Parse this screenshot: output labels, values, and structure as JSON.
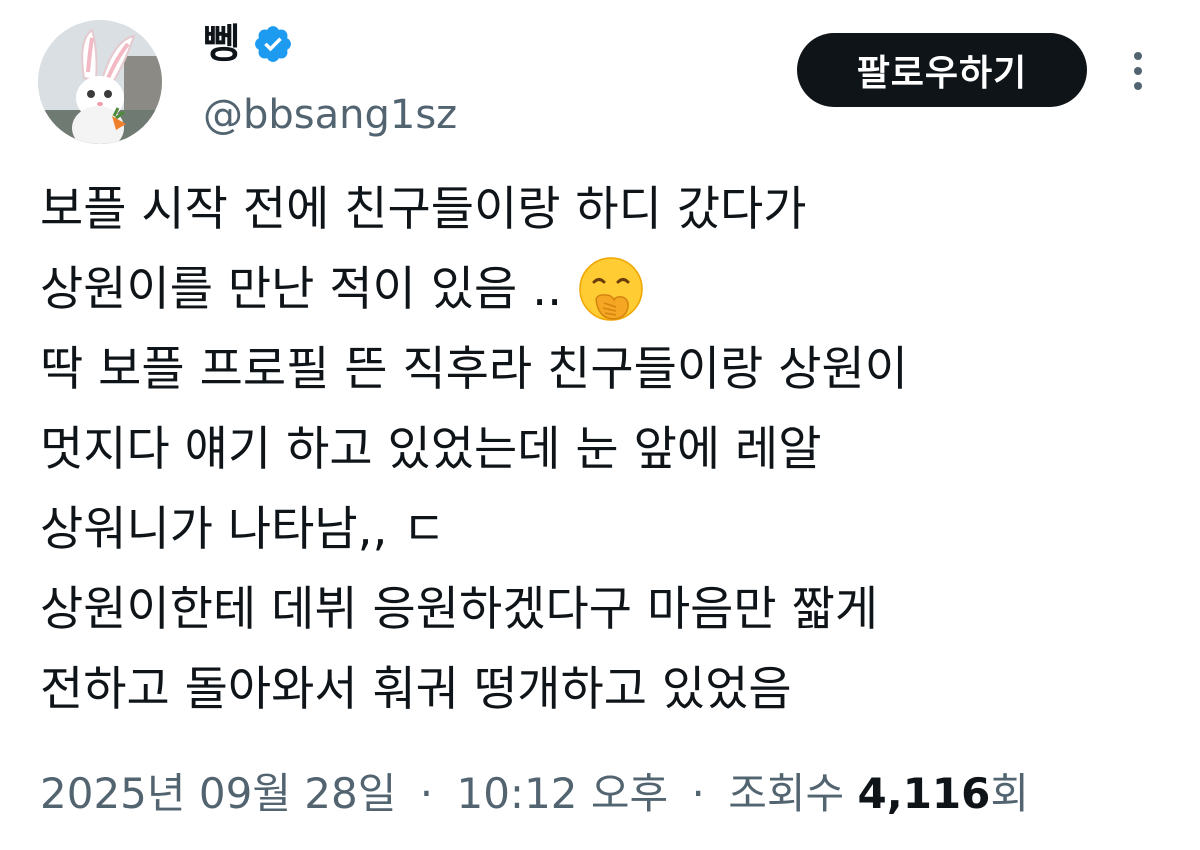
{
  "author": {
    "display_name": "뼁",
    "handle": "@bbsang1sz",
    "verified_icon": "verified-badge-icon",
    "avatar_icon": "white-bunny-avatar",
    "verified_color": "#1d9bf0"
  },
  "follow_button": {
    "label": "팔로우하기",
    "color": "#0f1419"
  },
  "more_menu": {
    "icon": "vertical-dots-icon"
  },
  "tweet": {
    "lines": [
      "보플 시작 전에 친구들이랑 하디 갔다가",
      "상원이를 만난 적이 있음 ..",
      "딱 보플 프로필 뜬 직후라 친구들이랑 상원이",
      "멋지다 얘기 하고 있었는데 눈 앞에 레알",
      "상워니가 나타남,, ㄷ",
      "상원이한테 데뷔 응원하겠다구 마음만 짧게",
      "전하고 돌아와서 훠궈 떵개하고 있었음"
    ],
    "emoji": "face-with-hand-over-mouth-icon"
  },
  "meta": {
    "date": "2025년 09월 28일",
    "separator": "·",
    "time": "10:12 오후",
    "views_label": "조회수",
    "views_count": "4,116",
    "views_suffix": "회"
  }
}
